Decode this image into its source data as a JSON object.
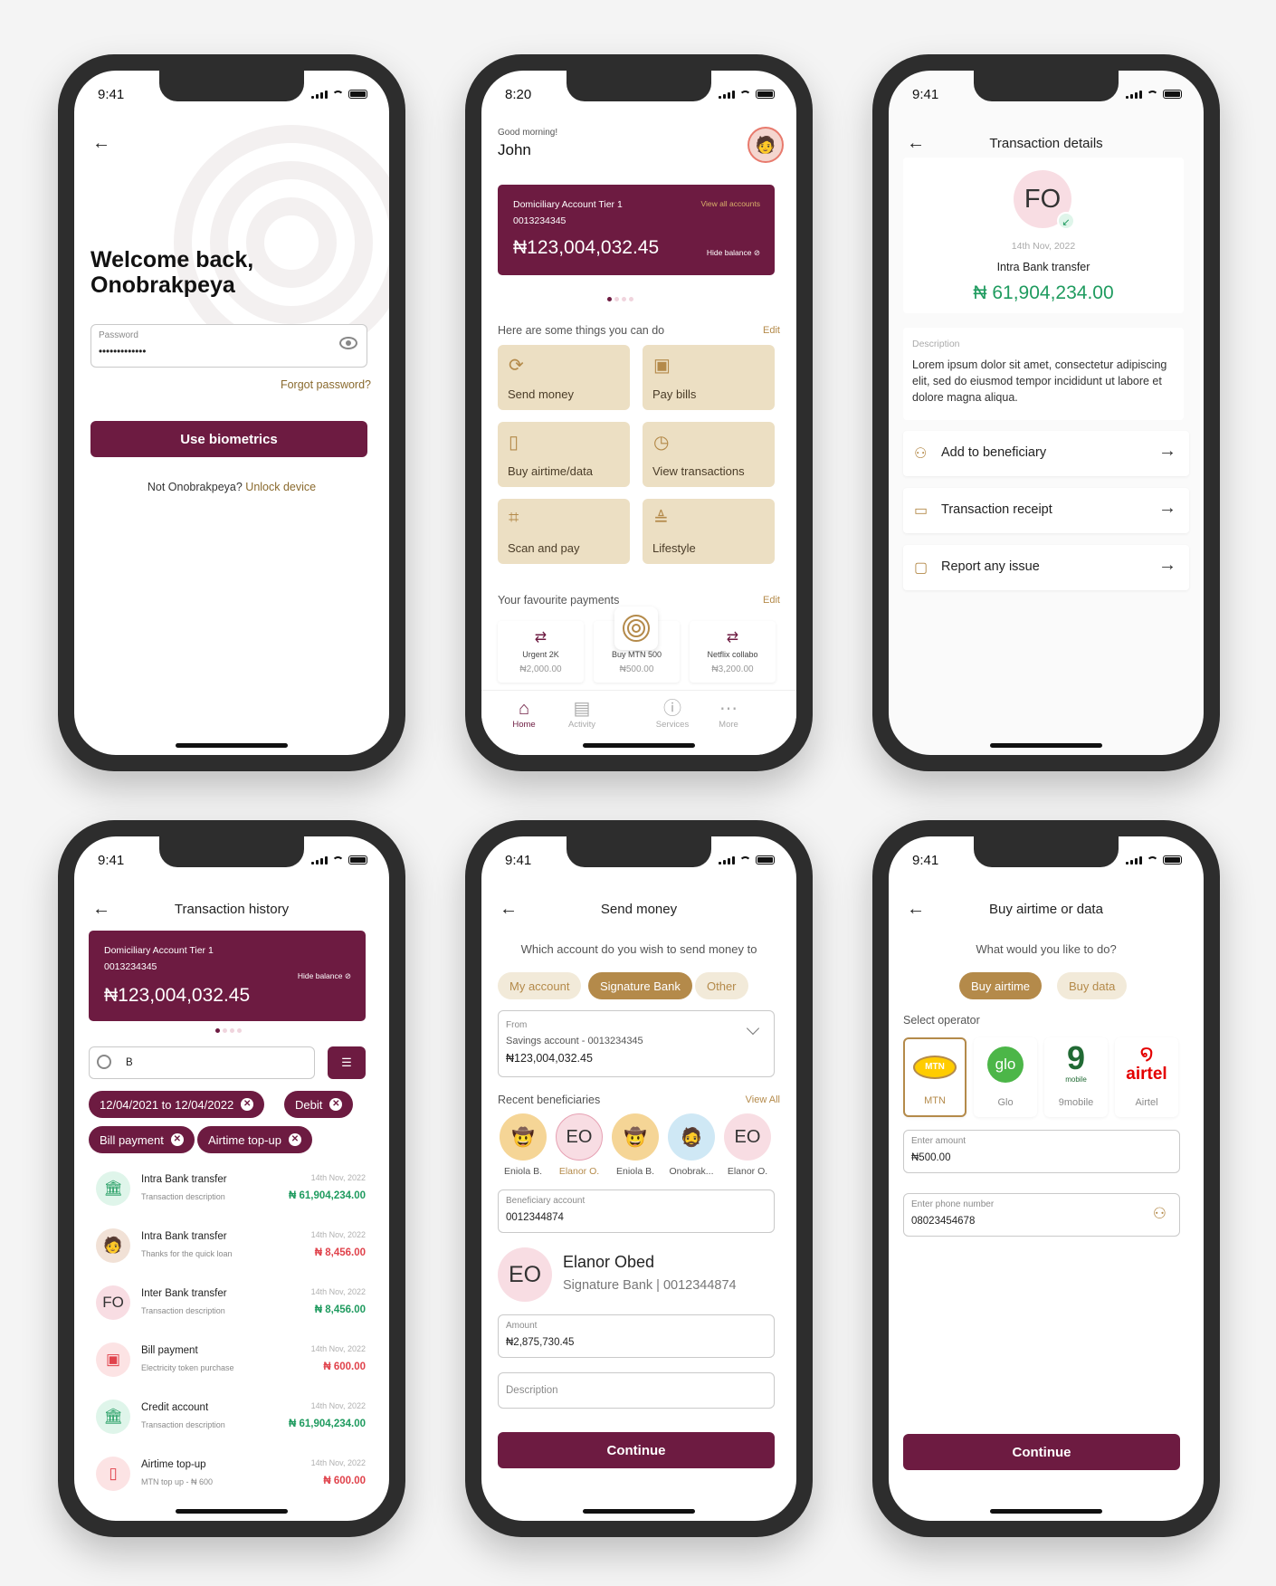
{
  "status": {
    "time_a": "9:41",
    "time_b": "8:20"
  },
  "login": {
    "title_line1": "Welcome back,",
    "title_line2": "Onobrakpeya",
    "password_label": "Password",
    "password_value": "•••••••••••••",
    "forgot": "Forgot password?",
    "biometrics": "Use biometrics",
    "not_user": "Not Onobrakpeya?",
    "unlock": "Unlock device"
  },
  "home": {
    "greeting": "Good morning!",
    "name": "John",
    "account_type": "Domiciliary Account Tier 1",
    "account_number": "0013234345",
    "view_all": "View all accounts",
    "balance": "₦123,004,032.45",
    "hide_balance": "Hide balance",
    "things_title": "Here are some things you can do",
    "edit": "Edit",
    "tiles": [
      "Send money",
      "Pay bills",
      "Buy airtime/data",
      "View transactions",
      "Scan and pay",
      "Lifestyle"
    ],
    "fav_title": "Your favourite payments",
    "favs": [
      {
        "name": "Urgent 2K",
        "amount": "₦2,000.00"
      },
      {
        "name": "Buy MTN 500",
        "amount": "₦500.00"
      },
      {
        "name": "Netflix collabo",
        "amount": "₦3,200.00"
      }
    ],
    "tabs": [
      "Home",
      "Activity",
      "Services",
      "More"
    ]
  },
  "details": {
    "title": "Transaction details",
    "initials": "FO",
    "date": "14th Nov, 2022",
    "type": "Intra Bank transfer",
    "amount": "₦ 61,904,234.00",
    "desc_label": "Description",
    "desc_text": "Lorem ipsum dolor sit amet, consectetur adipiscing elit, sed do eiusmod tempor incididunt ut labore et dolore magna aliqua.",
    "actions": [
      "Add to beneficiary",
      "Transaction receipt",
      "Report any issue"
    ]
  },
  "history": {
    "title": "Transaction history",
    "account_type": "Domiciliary Account Tier 1",
    "account_number": "0013234345",
    "hide_balance": "Hide balance",
    "balance": "₦123,004,032.45",
    "search_value": "B",
    "filters": [
      "12/04/2021 to 12/04/2022",
      "Debit",
      "Bill payment",
      "Airtime top-up"
    ],
    "rows": [
      {
        "name": "Intra Bank transfer",
        "desc": "Transaction description",
        "date": "14th Nov, 2022",
        "amount": "₦ 61,904,234.00"
      },
      {
        "name": "Intra Bank transfer",
        "desc": "Thanks for the quick loan",
        "date": "14th Nov, 2022",
        "amount": "₦ 8,456.00"
      },
      {
        "name": "Inter Bank transfer",
        "desc": "Transaction description",
        "date": "14th Nov, 2022",
        "amount": "₦ 8,456.00"
      },
      {
        "name": "Bill payment",
        "desc": "Electricity token purchase",
        "date": "14th Nov, 2022",
        "amount": "₦ 600.00"
      },
      {
        "name": "Credit account",
        "desc": "Transaction description",
        "date": "14th Nov, 2022",
        "amount": "₦ 61,904,234.00"
      },
      {
        "name": "Airtime top-up",
        "desc": "MTN top up - ₦ 600",
        "date": "14th Nov, 2022",
        "amount": "₦ 600.00"
      }
    ],
    "row_initials": "FO"
  },
  "send": {
    "title": "Send money",
    "question": "Which account do you wish to send money to",
    "chips": [
      "My account",
      "Signature Bank",
      "Other"
    ],
    "from_label": "From",
    "from_account": "Savings account - 0013234345",
    "from_balance": "₦123,004,032.45",
    "recent": "Recent beneficiaries",
    "view_all": "View All",
    "beneficiaries": [
      "Eniola B.",
      "Elanor O.",
      "Eniola B.",
      "Onobrak...",
      "Elanor O."
    ],
    "ben_initials": "EO",
    "ben_label": "Beneficiary account",
    "ben_value": "0012344874",
    "person_initials": "EO",
    "person_name": "Elanor Obed",
    "person_bank": "Signature Bank | 0012344874",
    "amount_label": "Amount",
    "amount_value": "₦2,875,730.45",
    "desc_placeholder": "Description",
    "continue": "Continue"
  },
  "airtime": {
    "title": "Buy airtime or data",
    "question": "What would you like to do?",
    "chips": [
      "Buy airtime",
      "Buy data"
    ],
    "select": "Select operator",
    "operators": [
      "MTN",
      "Glo",
      "9mobile",
      "Airtel"
    ],
    "logos": {
      "mtn": "MTN",
      "glo": "glo",
      "nine": "9",
      "nine_sub": "mobile",
      "airtel": "airtel"
    },
    "amount_label": "Enter amount",
    "amount_value": "₦500.00",
    "phone_label": "Enter phone number",
    "phone_value": "08023454678",
    "continue": "Continue"
  },
  "colors": {
    "brand": "#6d1b41",
    "accent": "#b48a4a",
    "credit": "#1f9b5f",
    "debit": "#e0424b"
  }
}
